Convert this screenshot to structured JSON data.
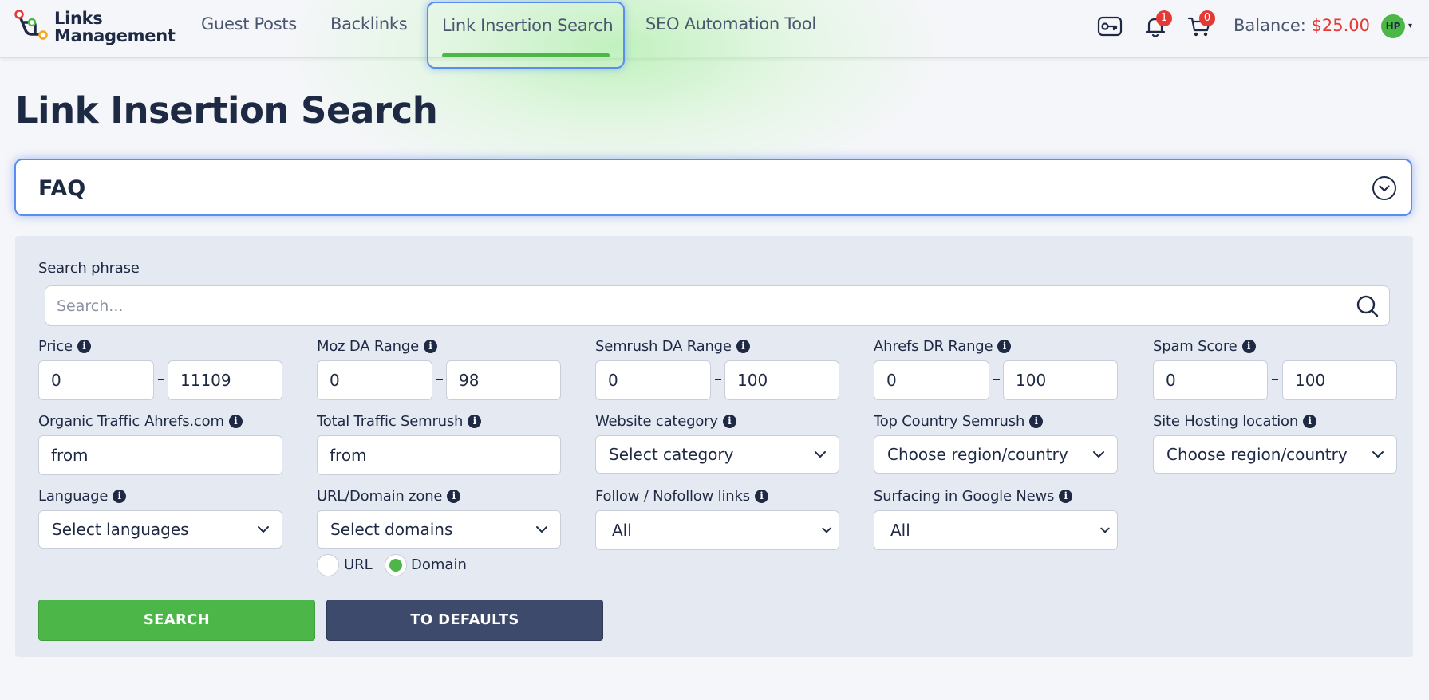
{
  "brand": {
    "line1": "Links",
    "line2": "Management"
  },
  "nav": {
    "items": [
      "Guest Posts",
      "Backlinks",
      "Link Insertion Search",
      "SEO Automation Tool"
    ],
    "active_index": 2
  },
  "header": {
    "notifications_count": "1",
    "cart_count": "0",
    "balance_label": "Balance:",
    "balance_amount": "$25.00",
    "avatar_initials": "HP"
  },
  "page": {
    "title": "Link Insertion Search"
  },
  "faq": {
    "label": "FAQ"
  },
  "filters": {
    "search": {
      "label": "Search phrase",
      "placeholder": "Search..."
    },
    "price": {
      "label": "Price",
      "from": "0",
      "to": "11109"
    },
    "moz_da": {
      "label": "Moz DA Range",
      "from": "0",
      "to": "98"
    },
    "semrush_da": {
      "label": "Semrush DA Range",
      "from": "0",
      "to": "100"
    },
    "ahrefs_dr": {
      "label": "Ahrefs DR Range",
      "from": "0",
      "to": "100"
    },
    "spam_score": {
      "label": "Spam Score",
      "from": "0",
      "to": "100"
    },
    "organic_traffic": {
      "label": "Organic Traffic",
      "link": "Ahrefs.com",
      "value": "from"
    },
    "total_traffic": {
      "label": "Total Traffic Semrush",
      "value": "from"
    },
    "website_category": {
      "label": "Website category",
      "value": "Select category"
    },
    "top_country": {
      "label": "Top Country Semrush",
      "value": "Choose region/country"
    },
    "hosting_location": {
      "label": "Site Hosting location",
      "value": "Choose region/country"
    },
    "language": {
      "label": "Language",
      "value": "Select languages"
    },
    "domain_zone": {
      "label": "URL/Domain zone",
      "value": "Select domains",
      "option_url": "URL",
      "option_domain": "Domain",
      "selected": "Domain"
    },
    "follow": {
      "label": "Follow / Nofollow links",
      "value": "All"
    },
    "google_news": {
      "label": "Surfacing in Google News",
      "value": "All"
    }
  },
  "actions": {
    "search": "SEARCH",
    "defaults": "TO DEFAULTS"
  },
  "colors": {
    "accent_green": "#4cb648",
    "dark_navy": "#1e2a44",
    "badge_red": "#e53935",
    "focus_blue": "#5b8cf0",
    "button_navy": "#3e4a6b"
  }
}
